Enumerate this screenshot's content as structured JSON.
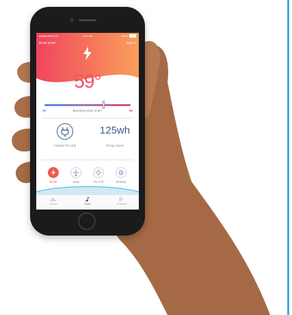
{
  "status_bar": {
    "carrier": "●●●●● Bell LTE",
    "time": "9:41 AM",
    "battery": "100%"
  },
  "header": {
    "left_text": "Boost active",
    "right_text": "Stop"
  },
  "temperature": {
    "current": "59°",
    "min": "25",
    "max": "86",
    "boost_label": "Boosting temp. to 60°",
    "slider_fraction": 0.69
  },
  "power": {
    "source_label": "Heating from grid",
    "energy_value": "125wh",
    "energy_label": "Energy saved"
  },
  "modes": [
    {
      "label": "Boost",
      "active": true,
      "icon": "bolt-icon"
    },
    {
      "label": "Away",
      "active": false,
      "icon": "plane-icon"
    },
    {
      "label": "No Grid",
      "active": false,
      "icon": "sun-icon"
    },
    {
      "label": "Settings",
      "active": false,
      "icon": "gear-icon"
    }
  ],
  "tabs": [
    {
      "label": "Stream",
      "icon": "chart-icon",
      "active": false
    },
    {
      "label": "Home",
      "icon": "music-icon",
      "active": true
    },
    {
      "label": "Schedule",
      "icon": "schedule-icon",
      "active": false
    }
  ],
  "colors": {
    "accent": "#ef4f6d",
    "gradient_start": "#f0455e",
    "gradient_end": "#fa9f5c",
    "navy": "#3f5d88",
    "border": "#3fb0e0"
  }
}
